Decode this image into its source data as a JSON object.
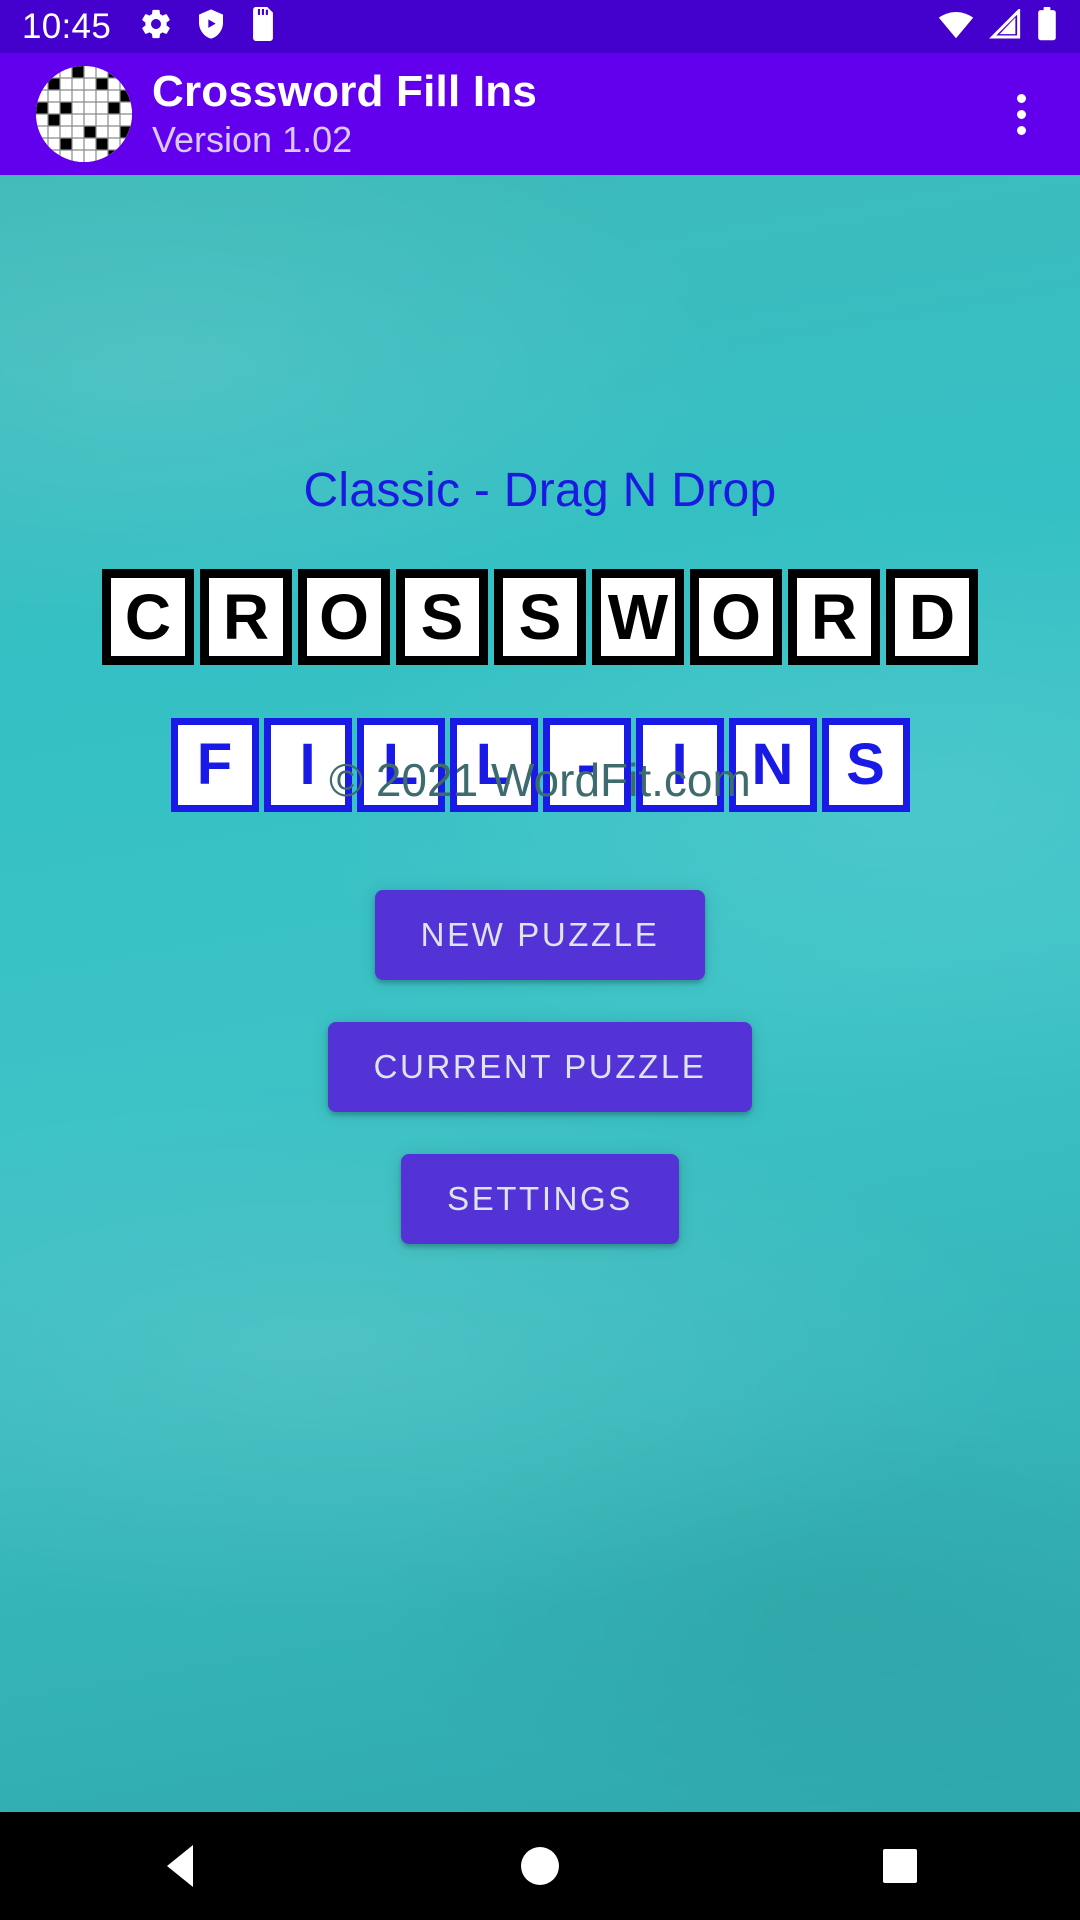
{
  "status_bar": {
    "clock": "10:45",
    "left_icons": [
      "gear-icon",
      "play-protect-shield-icon",
      "sd-card-icon"
    ],
    "right_icons": [
      "wifi-icon",
      "cellular-signal-icon",
      "battery-full-icon"
    ],
    "background": "#4400cc"
  },
  "app_bar": {
    "logo": "crossword-grid-logo",
    "title": "Crossword Fill Ins",
    "subtitle": "Version 1.02",
    "overflow": "more-options-icon",
    "background": "#6200ee"
  },
  "main": {
    "headline": "Classic - Drag N Drop",
    "headline_color": "#1a1ae0",
    "word_rows": [
      {
        "style": "black",
        "letters": [
          "C",
          "R",
          "O",
          "S",
          "S",
          "W",
          "O",
          "R",
          "D"
        ]
      },
      {
        "style": "blue",
        "letters": [
          "F",
          "I",
          "L",
          "L",
          "-",
          "I",
          "N",
          "S"
        ]
      }
    ],
    "copyright": "© 2021 WordFit.com",
    "buttons": [
      {
        "label": "NEW PUZZLE"
      },
      {
        "label": "CURRENT PUZZLE"
      },
      {
        "label": "SETTINGS"
      }
    ],
    "button_color": "#5433d6",
    "background_color": "#3cc3c6"
  },
  "nav_bar": {
    "back": "back-triangle-icon",
    "home": "home-circle-icon",
    "recents": "recents-square-icon"
  }
}
